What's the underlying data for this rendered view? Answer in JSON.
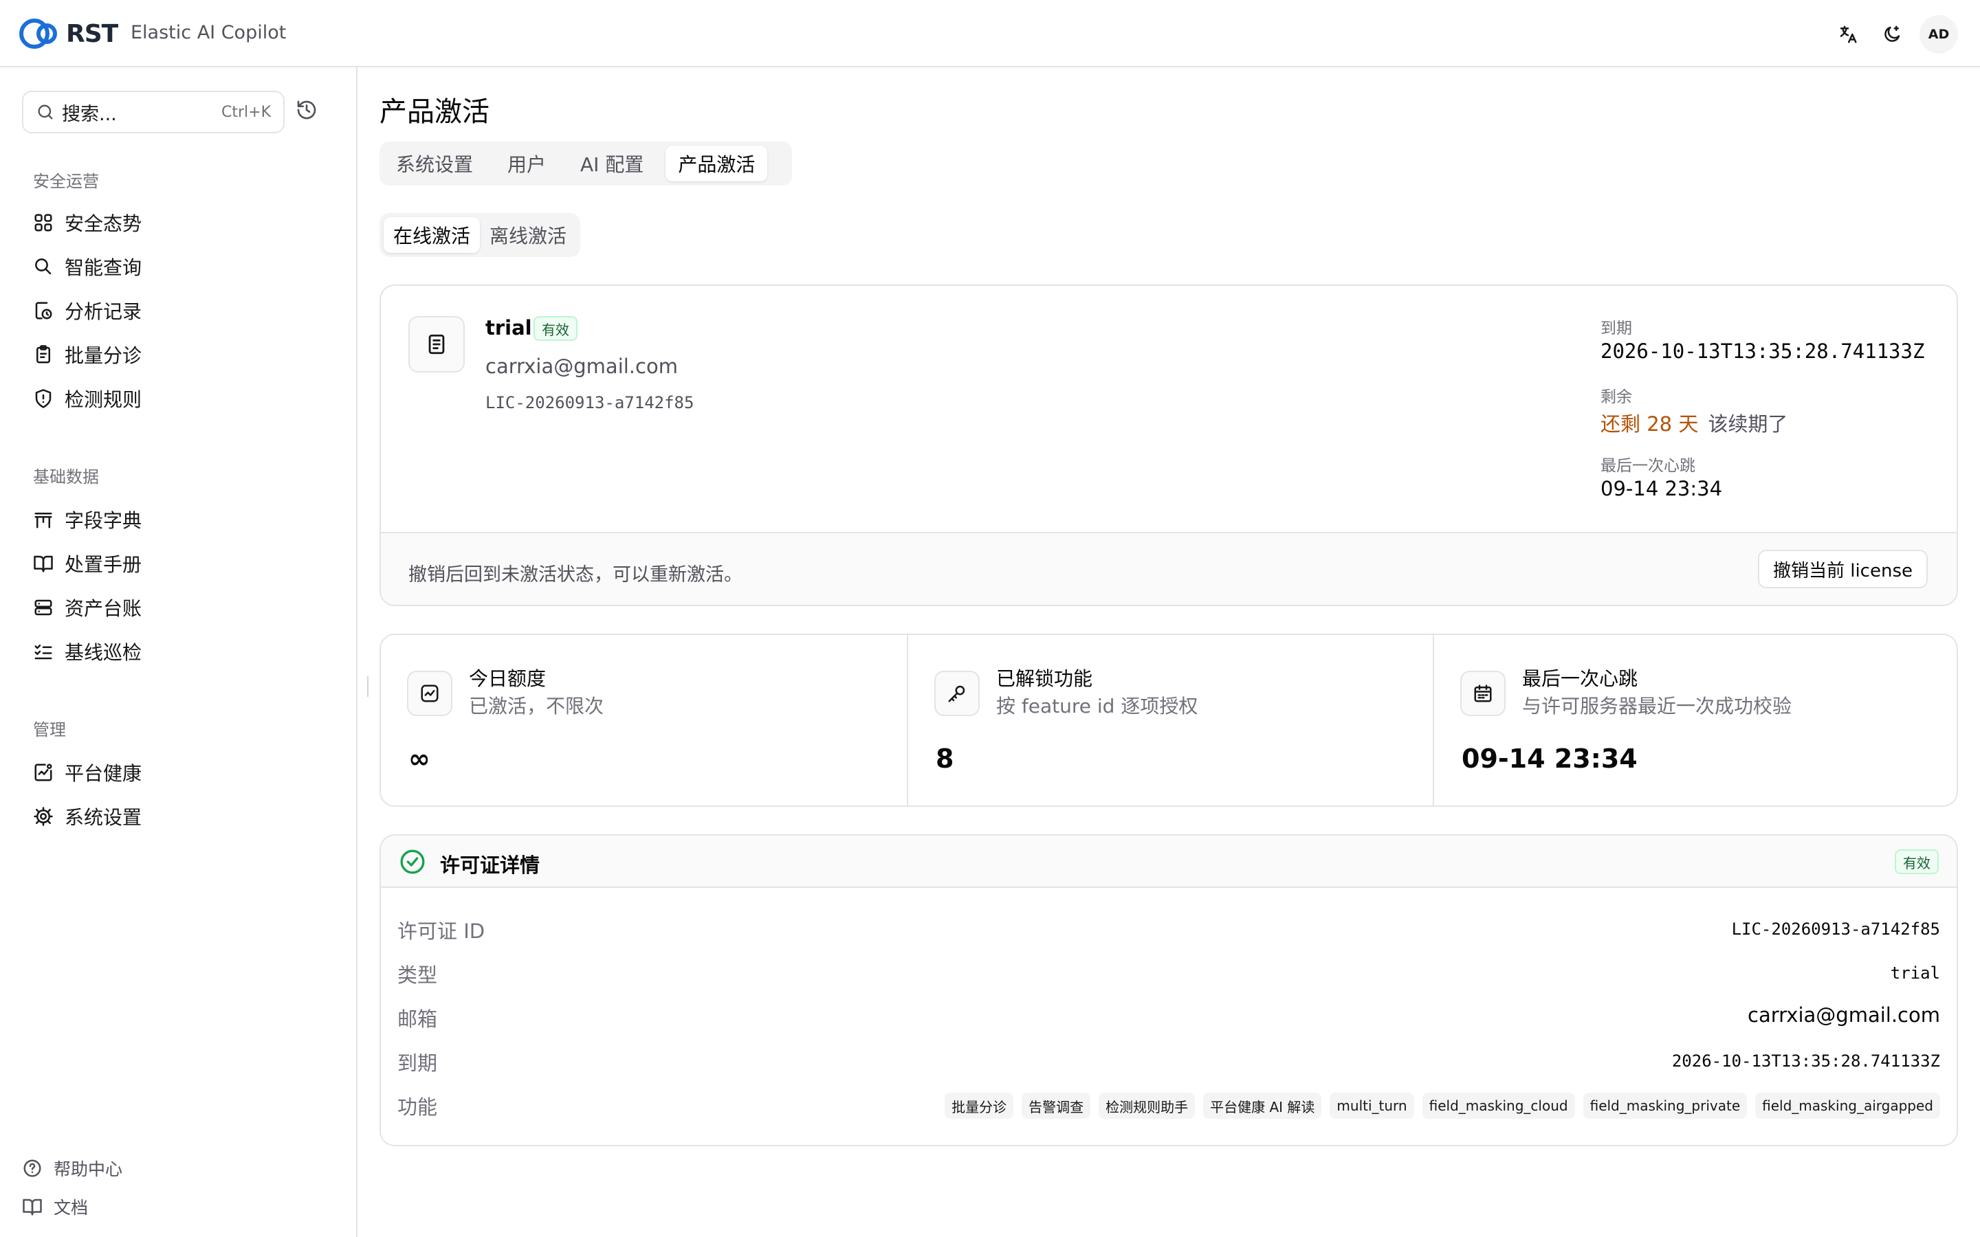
{
  "app": {
    "logo_text": "RST",
    "name": "Elastic AI Copilot",
    "avatar_initials": "AD"
  },
  "topbar": {
    "icons": [
      "translate-icon",
      "theme-toggle-icon"
    ]
  },
  "sidebar": {
    "search": {
      "placeholder": "搜索...",
      "shortcut": "Ctrl+K"
    },
    "sections": [
      {
        "title": "安全运营",
        "items": [
          {
            "label": "安全态势",
            "icon": "dashboard-grid-icon"
          },
          {
            "label": "智能查询",
            "icon": "search-icon"
          },
          {
            "label": "分析记录",
            "icon": "history-record-icon"
          },
          {
            "label": "批量分诊",
            "icon": "clipboard-icon"
          },
          {
            "label": "检测规则",
            "icon": "shield-alert-icon"
          }
        ]
      },
      {
        "title": "基础数据",
        "items": [
          {
            "label": "字段字典",
            "icon": "table-columns-icon"
          },
          {
            "label": "处置手册",
            "icon": "book-open-icon"
          },
          {
            "label": "资产台账",
            "icon": "server-icon"
          },
          {
            "label": "基线巡检",
            "icon": "list-checks-icon"
          }
        ]
      },
      {
        "title": "管理",
        "items": [
          {
            "label": "平台健康",
            "icon": "activity-square-icon"
          },
          {
            "label": "系统设置",
            "icon": "gear-icon"
          }
        ]
      }
    ],
    "footer": [
      {
        "label": "帮助中心",
        "icon": "help-circle-icon"
      },
      {
        "label": "文档",
        "icon": "book-icon"
      }
    ]
  },
  "main": {
    "page_title": "产品激活",
    "tabs": [
      {
        "label": "系统设置",
        "active": false
      },
      {
        "label": "用户",
        "active": false
      },
      {
        "label": "AI 配置",
        "active": false
      },
      {
        "label": "产品激活",
        "active": true
      }
    ],
    "subtabs": [
      {
        "label": "在线激活",
        "active": true
      },
      {
        "label": "离线激活",
        "active": false
      }
    ],
    "license": {
      "type": "trial",
      "status": "有效",
      "email": "carrxia@gmail.com",
      "id": "LIC-20260913-a7142f85",
      "expiry_label": "到期",
      "expiry_value": "2026-10-13T13:35:28.741133Z",
      "remain_label": "剩余",
      "remain_value": "还剩 28 天",
      "remain_note": "该续期了",
      "heartbeat_label": "最后一次心跳",
      "heartbeat_value": "09-14 23:34",
      "revoke_hint": "撤销后回到未激活状态，可以重新激活。",
      "revoke_button": "撤销当前 license"
    },
    "stats": [
      {
        "title": "今日额度",
        "subtitle": "已激活，不限次",
        "value": "∞",
        "icon": "chart-line-icon"
      },
      {
        "title": "已解锁功能",
        "subtitle": "按 feature id 逐项授权",
        "value": "8",
        "icon": "key-icon"
      },
      {
        "title": "最后一次心跳",
        "subtitle": "与许可服务器最近一次成功校验",
        "value": "09-14 23:34",
        "icon": "calendar-icon"
      }
    ],
    "details": {
      "title": "许可证详情",
      "status": "有效",
      "rows": [
        {
          "label": "许可证 ID",
          "value": "LIC-20260913-a7142f85"
        },
        {
          "label": "类型",
          "value": "trial"
        },
        {
          "label": "邮箱",
          "value": "carrxia@gmail.com"
        },
        {
          "label": "到期",
          "value": "2026-10-13T13:35:28.741133Z"
        }
      ],
      "features_label": "功能",
      "features": [
        "批量分诊",
        "告警调查",
        "检测规则助手",
        "平台健康 AI 解读",
        "multi_turn",
        "field_masking_cloud",
        "field_masking_private",
        "field_masking_airgapped"
      ]
    }
  },
  "colors": {
    "brand_blue": "#1d6fd8",
    "warning": "#b45309",
    "success": "#16a34a"
  }
}
